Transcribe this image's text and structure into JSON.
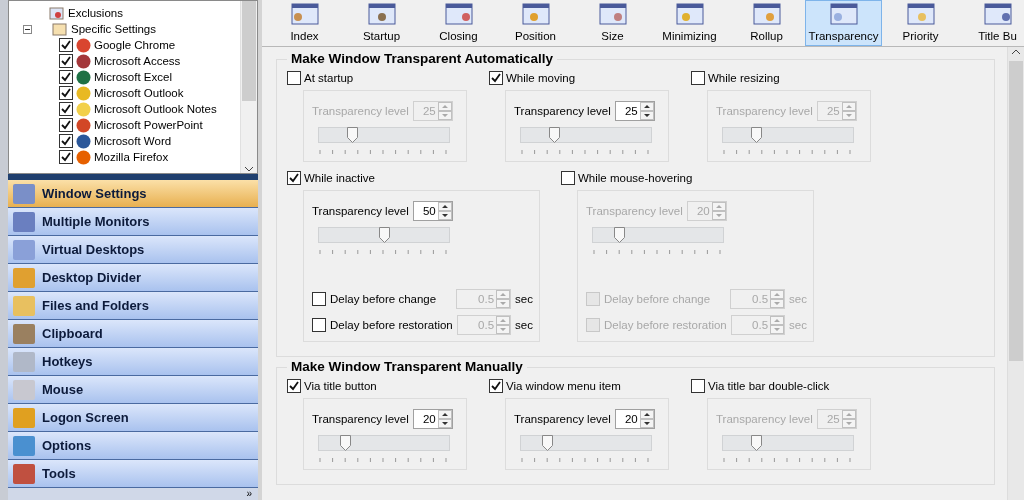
{
  "tree": {
    "items": [
      {
        "label": "Exclusions",
        "kind": "exclusions"
      },
      {
        "label": "Specific Settings",
        "kind": "folder",
        "expanded": true,
        "children": [
          {
            "label": "Google Chrome",
            "checked": true,
            "color": "#d9452f"
          },
          {
            "label": "Microsoft Access",
            "checked": true,
            "color": "#a4373a"
          },
          {
            "label": "Microsoft Excel",
            "checked": true,
            "color": "#1e7145"
          },
          {
            "label": "Microsoft Outlook",
            "checked": true,
            "color": "#e8b923"
          },
          {
            "label": "Microsoft Outlook Notes",
            "checked": true,
            "color": "#f2d04a"
          },
          {
            "label": "Microsoft PowerPoint",
            "checked": true,
            "color": "#d24726"
          },
          {
            "label": "Microsoft Word",
            "checked": true,
            "color": "#2b579a"
          },
          {
            "label": "Mozilla Firefox",
            "checked": true,
            "color": "#e66000"
          }
        ]
      }
    ]
  },
  "nav": [
    {
      "label": "Window Settings",
      "selected": true,
      "color": "#7a8fc8"
    },
    {
      "label": "Multiple Monitors",
      "selected": false,
      "color": "#6a7fc0"
    },
    {
      "label": "Virtual Desktops",
      "selected": false,
      "color": "#8aa0d8"
    },
    {
      "label": "Desktop Divider",
      "selected": false,
      "color": "#e0a030"
    },
    {
      "label": "Files and Folders",
      "selected": false,
      "color": "#e8c060"
    },
    {
      "label": "Clipboard",
      "selected": false,
      "color": "#9a8060"
    },
    {
      "label": "Hotkeys",
      "selected": false,
      "color": "#b0b8c8"
    },
    {
      "label": "Mouse",
      "selected": false,
      "color": "#c8c8d0"
    },
    {
      "label": "Logon Screen",
      "selected": false,
      "color": "#e0a020"
    },
    {
      "label": "Options",
      "selected": false,
      "color": "#4a90d0"
    },
    {
      "label": "Tools",
      "selected": false,
      "color": "#c05040"
    }
  ],
  "more": "»",
  "tabs": [
    {
      "label": "Index",
      "selected": false
    },
    {
      "label": "Startup",
      "selected": false
    },
    {
      "label": "Closing",
      "selected": false
    },
    {
      "label": "Position",
      "selected": false
    },
    {
      "label": "Size",
      "selected": false
    },
    {
      "label": "Minimizing",
      "selected": false
    },
    {
      "label": "Rollup",
      "selected": false
    },
    {
      "label": "Transparency",
      "selected": true
    },
    {
      "label": "Priority",
      "selected": false
    },
    {
      "label": "Title Bu",
      "selected": false
    }
  ],
  "groups": [
    {
      "title": "Make Window Transparent Automatically",
      "rows": [
        [
          {
            "label": "At startup",
            "checked": false,
            "field_label": "Transparency level",
            "value": "25",
            "level": 0.25
          },
          {
            "label": "While moving",
            "checked": true,
            "field_label": "Transparency level",
            "value": "25",
            "level": 0.25
          },
          {
            "label": "While resizing",
            "checked": false,
            "field_label": "Transparency level",
            "value": "25",
            "level": 0.25
          }
        ],
        [
          {
            "label": "While inactive",
            "checked": true,
            "field_label": "Transparency level",
            "value": "50",
            "level": 0.5,
            "delays": [
              {
                "label": "Delay before change",
                "checked": false,
                "value": "0.5",
                "unit": "sec"
              },
              {
                "label": "Delay before restoration",
                "checked": false,
                "value": "0.5",
                "unit": "sec"
              }
            ]
          },
          {
            "label": "While mouse-hovering",
            "checked": false,
            "field_label": "Transparency level",
            "value": "20",
            "level": 0.2,
            "delays": [
              {
                "label": "Delay before change",
                "checked": false,
                "value": "0.5",
                "unit": "sec"
              },
              {
                "label": "Delay before restoration",
                "checked": false,
                "value": "0.5",
                "unit": "sec"
              }
            ]
          }
        ]
      ]
    },
    {
      "title": "Make Window Transparent Manually",
      "rows": [
        [
          {
            "label": "Via title button",
            "checked": true,
            "field_label": "Transparency level",
            "value": "20",
            "level": 0.2
          },
          {
            "label": "Via window menu item",
            "checked": true,
            "field_label": "Transparency level",
            "value": "20",
            "level": 0.2
          },
          {
            "label": "Via title bar double-click",
            "checked": false,
            "field_label": "Transparency level",
            "value": "25",
            "level": 0.25
          }
        ]
      ]
    }
  ]
}
